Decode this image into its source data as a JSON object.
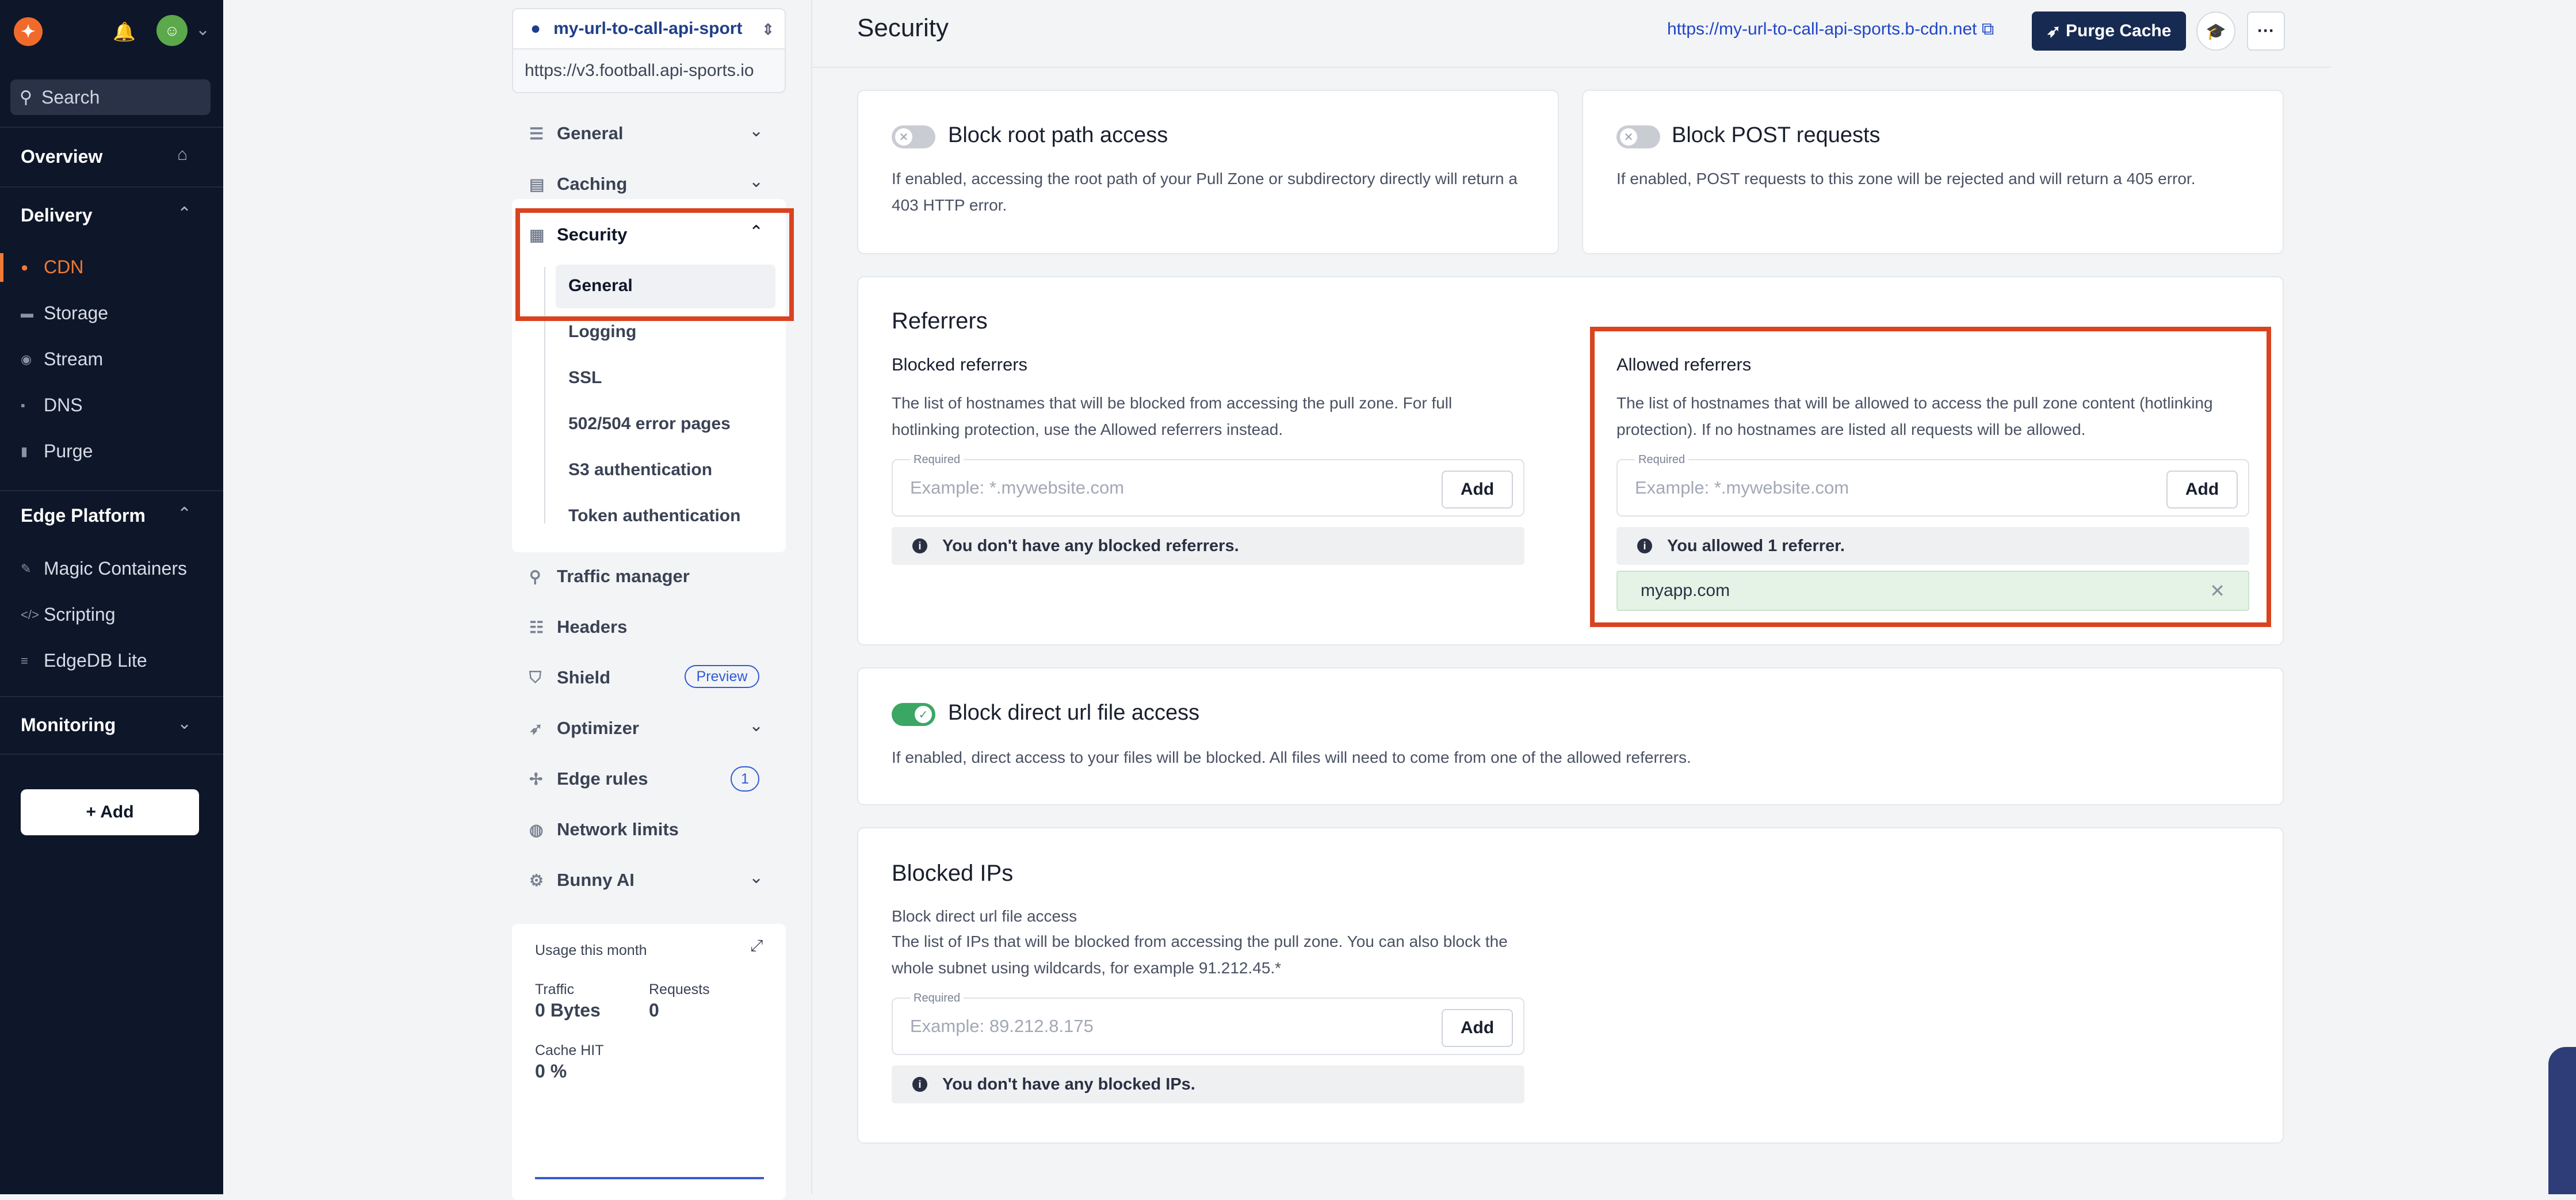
{
  "sidebar": {
    "search_placeholder": "Search",
    "overview": "Overview",
    "delivery_header": "Delivery",
    "delivery_items": [
      {
        "label": "CDN",
        "icon": "location-pin-icon"
      },
      {
        "label": "Storage",
        "icon": "storage-icon"
      },
      {
        "label": "Stream",
        "icon": "stream-icon"
      },
      {
        "label": "DNS",
        "icon": "dns-icon"
      },
      {
        "label": "Purge",
        "icon": "trash-icon"
      }
    ],
    "edge_header": "Edge Platform",
    "edge_items": [
      {
        "label": "Magic Containers",
        "icon": "magic-wand-icon"
      },
      {
        "label": "Scripting",
        "icon": "code-icon"
      },
      {
        "label": "EdgeDB Lite",
        "icon": "database-icon"
      }
    ],
    "monitoring_header": "Monitoring",
    "add_label": "+ Add",
    "accent_color": "#f07a34"
  },
  "zone": {
    "name": "my-url-to-call-api-sport",
    "origin": "https://v3.football.api-sports.io"
  },
  "subnav": {
    "items": [
      {
        "label": "General"
      },
      {
        "label": "Caching"
      },
      {
        "label": "Security"
      }
    ],
    "security_children": [
      "General",
      "Logging",
      "SSL",
      "502/504 error pages",
      "S3 authentication",
      "Token authentication"
    ],
    "lower_items": [
      {
        "label": "Traffic manager"
      },
      {
        "label": "Headers"
      },
      {
        "label": "Shield",
        "pill": "Preview"
      },
      {
        "label": "Optimizer"
      },
      {
        "label": "Edge rules",
        "badge": "1"
      },
      {
        "label": "Network limits"
      },
      {
        "label": "Bunny AI"
      }
    ]
  },
  "usage": {
    "title": "Usage this month",
    "traffic_label": "Traffic",
    "traffic_value": "0 Bytes",
    "requests_label": "Requests",
    "requests_value": "0",
    "cache_label": "Cache HIT",
    "cache_value": "0 %"
  },
  "header": {
    "title": "Security",
    "cdn_link": "https://my-url-to-call-api-sports.b-cdn.net",
    "purge_label": "Purge Cache"
  },
  "block_root": {
    "title": "Block root path access",
    "desc": "If enabled, accessing the root path of your Pull Zone or subdirectory directly will return a 403 HTTP error.",
    "enabled": false
  },
  "block_post": {
    "title": "Block POST requests",
    "desc": "If enabled, POST requests to this zone will be rejected and will return a 405 error.",
    "enabled": false
  },
  "referrers": {
    "title": "Referrers",
    "blocked_title": "Blocked referrers",
    "blocked_desc": "The list of hostnames that will be blocked from accessing the pull zone. For full hotlinking protection, use the Allowed referrers instead.",
    "blocked_field_label": "Required",
    "blocked_placeholder": "Example: *.mywebsite.com",
    "add_label": "Add",
    "blocked_empty": "You don't have any blocked referrers.",
    "allowed_title": "Allowed referrers",
    "allowed_desc": "The list of hostnames that will be allowed to access the pull zone content (hotlinking protection). If no hostnames are listed all requests will be allowed.",
    "allowed_field_label": "Required",
    "allowed_placeholder": "Example: *.mywebsite.com",
    "allowed_count_text": "You allowed 1 referrer.",
    "allowed_list": [
      "myapp.com"
    ]
  },
  "block_direct": {
    "title": "Block direct url file access",
    "desc": "If enabled, direct access to your files will be blocked. All files will need to come from one of the allowed referrers.",
    "enabled": true
  },
  "blocked_ips": {
    "title": "Blocked IPs",
    "subtitle": "Block direct url file access",
    "desc": "The list of IPs that will be blocked from accessing the pull zone. You can also block the whole subnet using wildcards, for example 91.212.45.*",
    "field_label": "Required",
    "placeholder": "Example: 89.212.8.175",
    "add_label": "Add",
    "empty": "You don't have any blocked IPs."
  }
}
